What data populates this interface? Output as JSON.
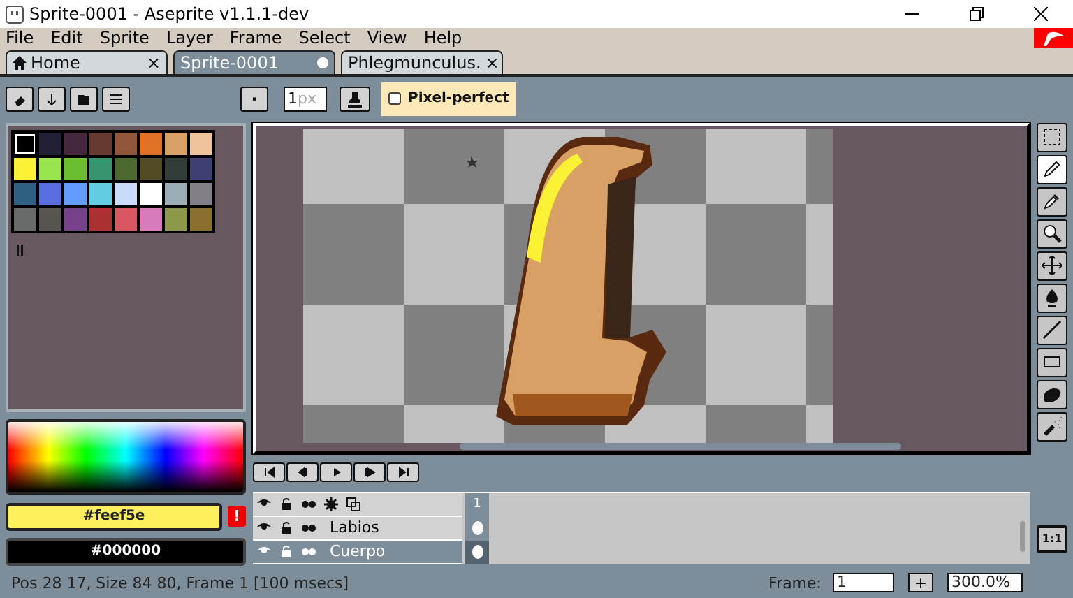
{
  "window": {
    "title": "Sprite-0001 - Aseprite v1.1.1-dev"
  },
  "menu": [
    "File",
    "Edit",
    "Sprite",
    "Layer",
    "Frame",
    "Select",
    "View",
    "Help"
  ],
  "tabs": [
    {
      "label": "Home",
      "kind": "home",
      "selected": false,
      "modified": false,
      "close_glyph": "×"
    },
    {
      "label": "Sprite-0001",
      "kind": "sprite",
      "selected": true,
      "modified": true
    },
    {
      "label": "Phlegmunculus.",
      "kind": "sprite",
      "selected": false,
      "modified": false,
      "close_glyph": "×"
    }
  ],
  "toolbar": {
    "dot_button": "·",
    "brush_size": "1",
    "brush_unit": "px",
    "pixel_perfect": {
      "label": "Pixel-perfect",
      "checked": false
    }
  },
  "palette": {
    "colors": [
      {
        "color": "#000000",
        "selected": true
      },
      {
        "color": "#222034",
        "selected": false
      },
      {
        "color": "#45283c",
        "selected": false
      },
      {
        "color": "#663931",
        "selected": false
      },
      {
        "color": "#8f563b",
        "selected": false
      },
      {
        "color": "#df7126",
        "selected": false
      },
      {
        "color": "#d9a066",
        "selected": false
      },
      {
        "color": "#eec39a",
        "selected": false
      },
      {
        "color": "#fbf236",
        "selected": false
      },
      {
        "color": "#99e550",
        "selected": false
      },
      {
        "color": "#6abe30",
        "selected": false
      },
      {
        "color": "#37946e",
        "selected": false
      },
      {
        "color": "#4b692f",
        "selected": false
      },
      {
        "color": "#524b24",
        "selected": false
      },
      {
        "color": "#323c39",
        "selected": false
      },
      {
        "color": "#3f3f74",
        "selected": false
      },
      {
        "color": "#306082",
        "selected": false
      },
      {
        "color": "#5b6ee1",
        "selected": false
      },
      {
        "color": "#639bff",
        "selected": false
      },
      {
        "color": "#5fcde4",
        "selected": false
      },
      {
        "color": "#cbdbfc",
        "selected": false
      },
      {
        "color": "#ffffff",
        "selected": false
      },
      {
        "color": "#9badb7",
        "selected": false
      },
      {
        "color": "#847e87",
        "selected": false
      },
      {
        "color": "#696a6a",
        "selected": false
      },
      {
        "color": "#595652",
        "selected": false
      },
      {
        "color": "#76428a",
        "selected": false
      },
      {
        "color": "#ac3232",
        "selected": false
      },
      {
        "color": "#d95763",
        "selected": false
      },
      {
        "color": "#d77bba",
        "selected": false
      },
      {
        "color": "#8f974a",
        "selected": false
      },
      {
        "color": "#8a6f30",
        "selected": false
      }
    ]
  },
  "colors": {
    "foreground": {
      "label": "#feef5e",
      "color": "#feef5e"
    },
    "background": {
      "label": "#000000",
      "color": "#000000"
    },
    "warning": "!"
  },
  "frames": [
    {
      "label": "1"
    }
  ],
  "layers": [
    {
      "name": "Labios",
      "selected": false
    },
    {
      "name": "Cuerpo",
      "selected": true
    }
  ],
  "tools": [
    {
      "kind": "marquee",
      "selected": false
    },
    {
      "kind": "pencil",
      "selected": true
    },
    {
      "kind": "eyedropper",
      "selected": false
    },
    {
      "kind": "zoom",
      "selected": false
    },
    {
      "kind": "move",
      "selected": false
    },
    {
      "kind": "fill",
      "selected": false
    },
    {
      "kind": "line",
      "selected": false
    },
    {
      "kind": "rectangle",
      "selected": false
    },
    {
      "kind": "contour",
      "selected": false
    },
    {
      "kind": "spray",
      "selected": false
    }
  ],
  "zoom_reset": "1:1",
  "status": {
    "text": "Pos 28 17, Size 84 80, Frame 1 [100 msecs]",
    "frame_label": "Frame:",
    "frame": "1",
    "add": "+",
    "zoom": "300.0%"
  }
}
